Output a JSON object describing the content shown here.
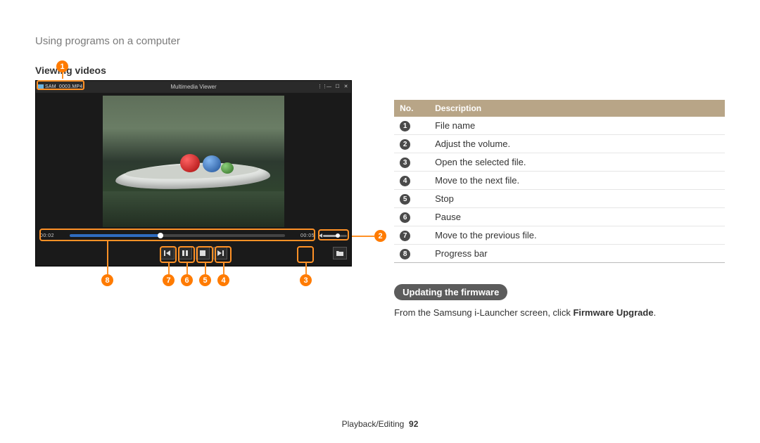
{
  "breadcrumb": "Using programs on a computer",
  "section_viewing_title": "Viewing videos",
  "viewer": {
    "filename": "SAM_0003.MP4",
    "window_title": "Multimedia Viewer",
    "time_elapsed": "00:02",
    "time_total": "00:05",
    "progress_percent": 42,
    "volume_percent": 55
  },
  "callouts": {
    "b1": "1",
    "b2": "2",
    "b3": "3",
    "b4": "4",
    "b5": "5",
    "b6": "6",
    "b7": "7",
    "b8": "8"
  },
  "table": {
    "header_no": "No.",
    "header_desc": "Description",
    "rows": [
      {
        "n": "1",
        "d": "File name"
      },
      {
        "n": "2",
        "d": "Adjust the volume."
      },
      {
        "n": "3",
        "d": "Open the selected file."
      },
      {
        "n": "4",
        "d": "Move to the next file."
      },
      {
        "n": "5",
        "d": "Stop"
      },
      {
        "n": "6",
        "d": "Pause"
      },
      {
        "n": "7",
        "d": "Move to the previous file."
      },
      {
        "n": "8",
        "d": "Progress bar"
      }
    ]
  },
  "firmware": {
    "pill": "Updating the firmware",
    "text_before": "From the Samsung i-Launcher screen, click ",
    "text_bold": "Firmware Upgrade",
    "text_after": "."
  },
  "footer": {
    "section": "Playback/Editing",
    "page": "92"
  }
}
